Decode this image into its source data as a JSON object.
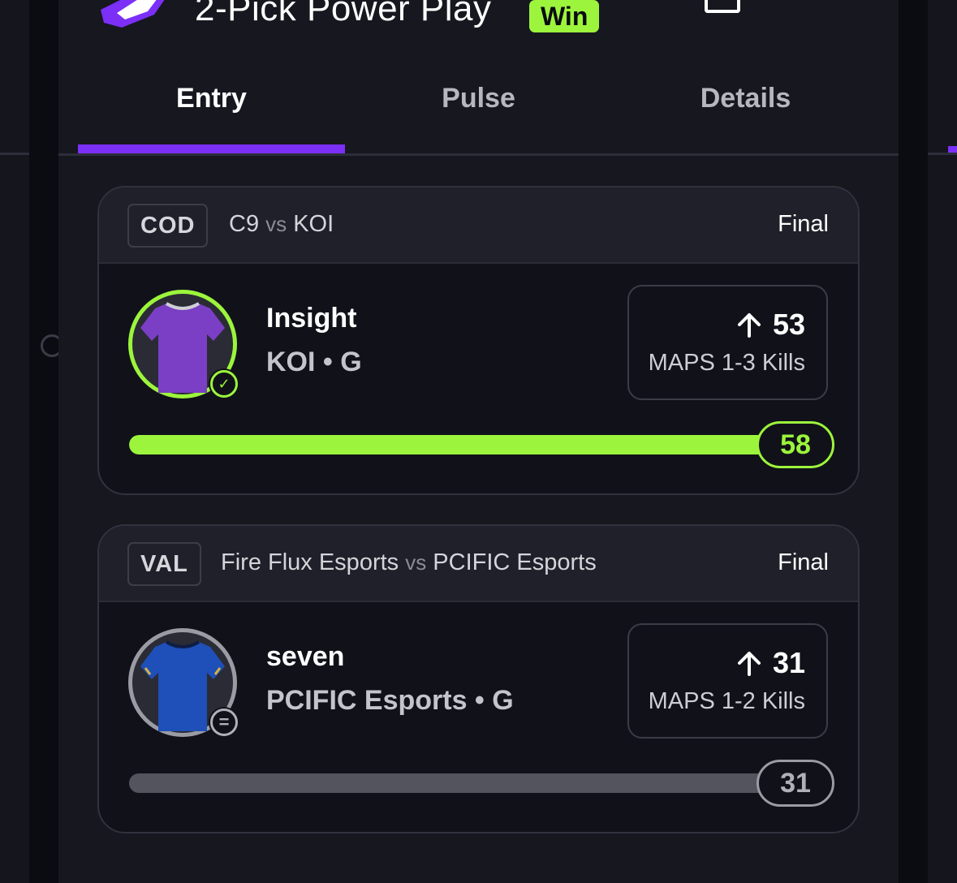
{
  "header": {
    "title": "2-Pick Power Play",
    "result_badge": "Win",
    "colors": {
      "accent": "#7b2ff7",
      "win": "#9cf53c"
    }
  },
  "tabs": [
    {
      "label": "Entry",
      "active": true
    },
    {
      "label": "Pulse",
      "active": false
    },
    {
      "label": "Details",
      "active": false
    }
  ],
  "picks": [
    {
      "league": "COD",
      "team_a": "C9",
      "vs": "vs",
      "team_b": "KOI",
      "status": "Final",
      "player": "Insight",
      "team_position": "KOI • G",
      "direction": "up-arrow-icon",
      "line": "53",
      "stat": "MAPS 1-3 Kills",
      "result": "58",
      "progress": 1.0,
      "outcome": "hit",
      "badge_icon": "check-icon",
      "jersey_color": "#7a3fc4"
    },
    {
      "league": "VAL",
      "team_a": "Fire Flux Esports",
      "vs": "vs",
      "team_b": "PCIFIC Esports",
      "status": "Final",
      "player": "seven",
      "team_position": "PCIFIC Esports • G",
      "direction": "up-arrow-icon",
      "line": "31",
      "stat": "MAPS 1-2 Kills",
      "result": "31",
      "progress": 1.0,
      "outcome": "push",
      "badge_icon": "equals-icon",
      "jersey_color": "#1f4fb8"
    }
  ]
}
